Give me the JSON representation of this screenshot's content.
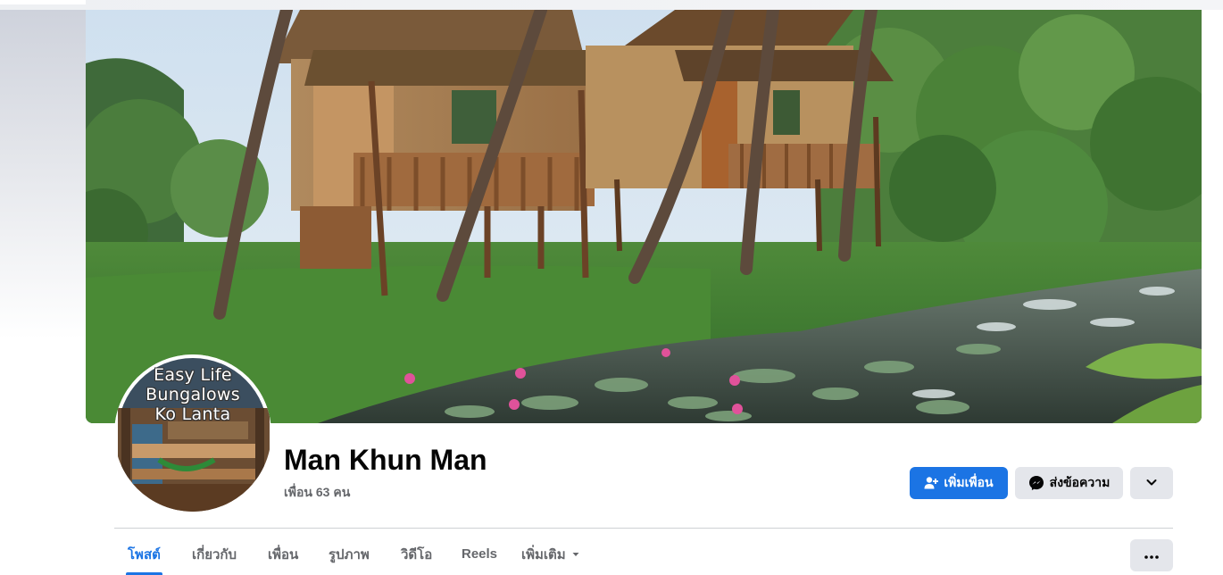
{
  "profile": {
    "name": "Man Khun Man",
    "friends_text": "เพื่อน 63 คน",
    "avatar_text": {
      "line1": "Easy Life",
      "line2": "Bungalows",
      "line3": "Ko Lanta"
    }
  },
  "cover": {
    "icon": "bungalow-photo"
  },
  "actions": {
    "add_friend_label": "เพิ่มเพื่อน",
    "add_friend_icon": "add-friend-icon",
    "message_label": "ส่งข้อความ",
    "message_icon": "messenger-icon",
    "more_icon": "chevron-down-icon"
  },
  "tabs": [
    {
      "label": "โพสต์",
      "active": true
    },
    {
      "label": "เกี่ยวกับ",
      "active": false
    },
    {
      "label": "เพื่อน",
      "active": false
    },
    {
      "label": "รูปภาพ",
      "active": false
    },
    {
      "label": "วิดีโอ",
      "active": false
    },
    {
      "label": "Reels",
      "active": false
    },
    {
      "label": "เพิ่มเติม",
      "active": false
    }
  ],
  "tab_more_icon": "caret-down-icon",
  "overflow_icon": "more-dots-icon",
  "colors": {
    "accent": "#1b74e4",
    "secondary_button": "#e4e6eb",
    "text_primary": "#050505",
    "text_secondary": "#65676b"
  }
}
